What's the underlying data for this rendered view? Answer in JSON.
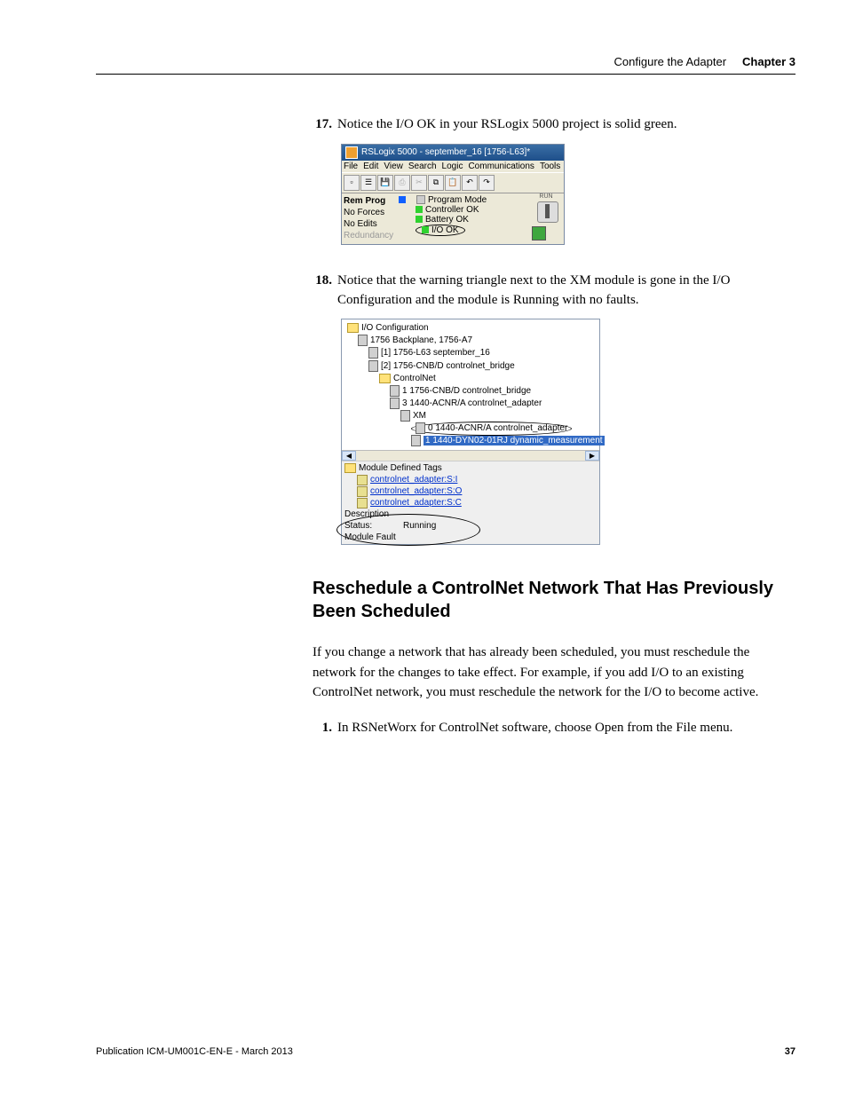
{
  "header": {
    "title": "Configure the Adapter",
    "chapter": "Chapter 3"
  },
  "steps": {
    "s17": {
      "num": "17",
      "text": "Notice the I/O OK in your RSLogix 5000 project is solid green."
    },
    "s18": {
      "num": "18",
      "text": "Notice that the warning triangle next to the XM module is gone in the I/O Configuration and the module is Running with no faults."
    },
    "s1b": {
      "num": "1",
      "text": "In RSNetWorx for ControlNet software, choose Open from the File menu."
    }
  },
  "shot1": {
    "title": "RSLogix 5000 - september_16 [1756-L63]*",
    "menu": [
      "File",
      "Edit",
      "View",
      "Search",
      "Logic",
      "Communications",
      "Tools"
    ],
    "status_col1": [
      "Rem Prog",
      "No Forces",
      "No Edits",
      "Redundancy"
    ],
    "status_rows": [
      "Program Mode",
      "Controller OK",
      "Battery OK",
      "I/O OK"
    ],
    "key_label": "RUN"
  },
  "shot2": {
    "tree": {
      "n0": "I/O Configuration",
      "n1": "1756 Backplane, 1756-A7",
      "n2": "[1] 1756-L63 september_16",
      "n3": "[2] 1756-CNB/D controlnet_bridge",
      "n4": "ControlNet",
      "n5": "1 1756-CNB/D controlnet_bridge",
      "n6": "3 1440-ACNR/A controlnet_adapter",
      "n7": "XM",
      "n8": "0 1440-ACNR/A controlnet_adapter",
      "n9": "1 1440-DYN02-01RJ dynamic_measurement"
    },
    "lower": {
      "title": "Module Defined Tags",
      "tags": [
        "controlnet_adapter:S:I",
        "controlnet_adapter:S:O",
        "controlnet_adapter:S:C"
      ],
      "desc_label": "Description",
      "status_label": "Status:",
      "status_value": "Running",
      "fault_label": "Module Fault"
    }
  },
  "section": {
    "title": "Reschedule a ControlNet Network That Has Previously Been Scheduled",
    "para": "If you change a network that has already been scheduled, you must reschedule the network for the changes to take effect. For example, if you add I/O to an existing ControlNet network, you must reschedule the network for the I/O to become active."
  },
  "footer": {
    "pub": "Publication ICM-UM001C-EN-E - March 2013",
    "page": "37"
  }
}
